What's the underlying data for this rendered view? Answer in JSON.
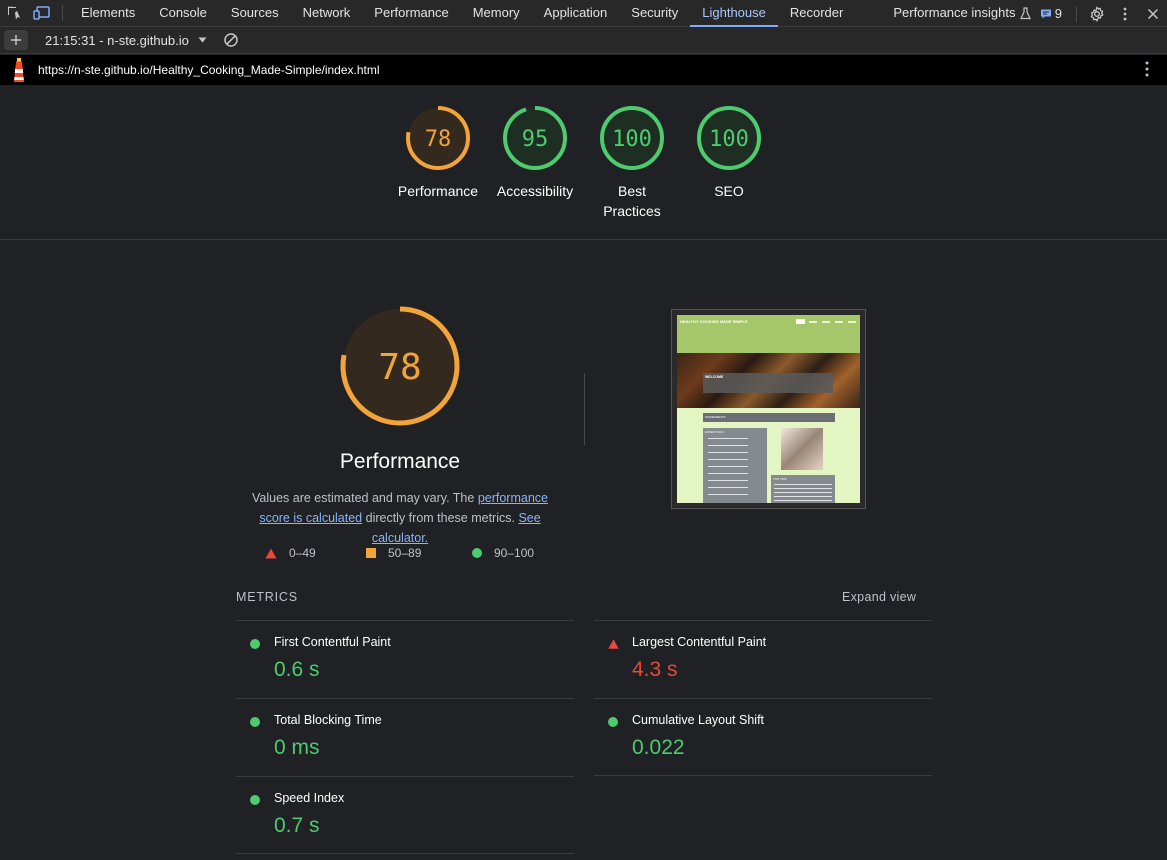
{
  "devtools": {
    "tabs": [
      "Elements",
      "Console",
      "Sources",
      "Network",
      "Performance",
      "Memory",
      "Application",
      "Security",
      "Lighthouse",
      "Recorder",
      "Performance insights"
    ],
    "active_tab": "Lighthouse",
    "issues_count": "9"
  },
  "toolbar": {
    "report": "21:15:31 - n-ste.github.io"
  },
  "url": "https://n-ste.github.io/Healthy_Cooking_Made-Simple/index.html",
  "scores": [
    {
      "label": "Performance",
      "value": "78",
      "color": "#f2a33a"
    },
    {
      "label": "Accessibility",
      "value": "95",
      "color": "#4dcb6e"
    },
    {
      "label": "Best Practices",
      "value": "100",
      "color": "#4dcb6e"
    },
    {
      "label": "SEO",
      "value": "100",
      "color": "#4dcb6e"
    }
  ],
  "perf": {
    "score": "78",
    "title": "Performance",
    "desc_pre": "Values are estimated and may vary. The ",
    "desc_link1": "performance score is calculated",
    "desc_mid": " directly from these metrics. ",
    "desc_link2": "See calculator."
  },
  "legend": [
    {
      "range": "0–49",
      "shape": "triangle",
      "color": "#e8483c"
    },
    {
      "range": "50–89",
      "shape": "square",
      "color": "#f2a33a"
    },
    {
      "range": "90–100",
      "shape": "circle",
      "color": "#4dcb6e"
    }
  ],
  "metrics": {
    "heading": "METRICS",
    "expand": "Expand view",
    "items": [
      {
        "name": "First Contentful Paint",
        "value": "0.6 s",
        "status": "good"
      },
      {
        "name": "Largest Contentful Paint",
        "value": "4.3 s",
        "status": "poor"
      },
      {
        "name": "Total Blocking Time",
        "value": "0 ms",
        "status": "good"
      },
      {
        "name": "Cumulative Layout Shift",
        "value": "0.022",
        "status": "good"
      },
      {
        "name": "Speed Index",
        "value": "0.7 s",
        "status": "good"
      }
    ]
  },
  "thumbnail": {
    "site_title": "HEALTHY COOKING MADE SIMPLE",
    "welcome": "WELCOME",
    "section1": "INGREDIENTS",
    "section2": "ESSENTIALS",
    "section3": "TOP TIPS"
  }
}
